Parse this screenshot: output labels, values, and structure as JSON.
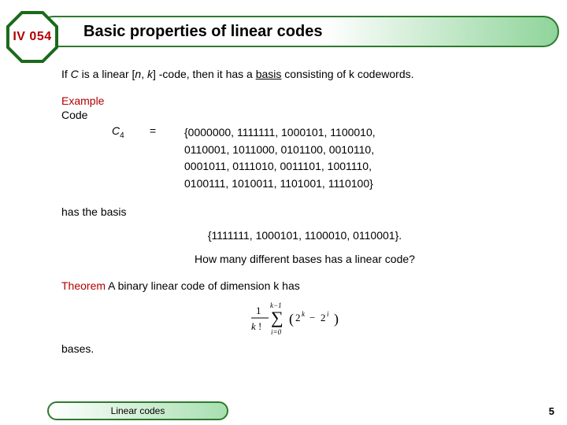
{
  "badge": "IV 054",
  "title": "Basic properties of linear codes",
  "intro": {
    "p1": "If ",
    "C": "C",
    "p2": " is a linear [",
    "n": "n",
    "comma": ", ",
    "k": "k",
    "p3": "] -code, then it has a ",
    "basis": "basis",
    "p4": " consisting of k codewords."
  },
  "example_label": "Example",
  "code_label": "Code",
  "code_symbol": "C",
  "code_sub": "4",
  "eq": "=",
  "codeset": {
    "l1": "{0000000, 1111111, 1000101, 1100010,",
    "l2": "0110001, 1011000, 0101100, 0010110,",
    "l3": "0001011, 0111010, 0011101, 1001110,",
    "l4": "0100111, 1010011, 1101001, 1110100}"
  },
  "has_basis": "has the basis",
  "basis_set": "{1111111, 1000101, 1100010, 0110001}.",
  "question": "How many different bases has a linear code?",
  "theorem_label": "Theorem",
  "theorem_text": " A binary linear code of dimension k has",
  "bases_word": "bases.",
  "footer": "Linear codes",
  "page": "5"
}
